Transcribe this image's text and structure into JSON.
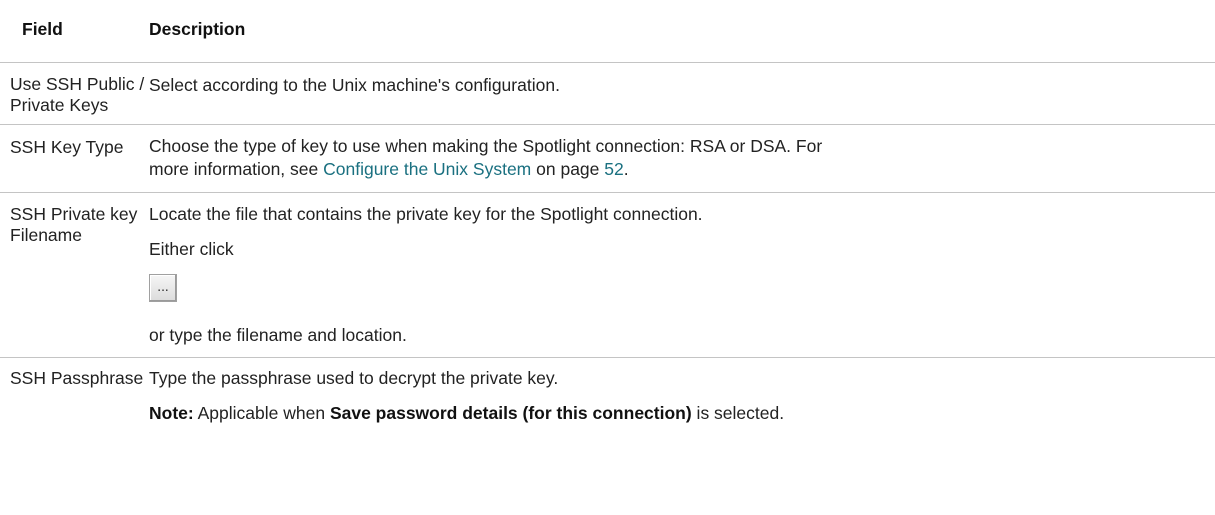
{
  "header": {
    "field": "Field",
    "description": "Description"
  },
  "rows": [
    {
      "field": "Use SSH Public / Private Keys",
      "description": "Select according to the Unix machine's configuration."
    },
    {
      "field": "SSH Key Type",
      "desc_line1": "Choose the type of key to use when making the Spotlight connection: RSA or DSA. For",
      "desc_line2_prefix": "more information, see ",
      "link_text": "Configure the Unix System",
      "desc_line2_mid": " on page ",
      "page_link": "52",
      "desc_line2_suffix": "."
    },
    {
      "field": "SSH Private key Filename",
      "desc_line1": "Locate the file that contains the private key for the Spotlight connection.",
      "desc_line2": "Either click",
      "button_label": "...",
      "desc_line3": "or type the filename and location."
    },
    {
      "field": "SSH Passphrase",
      "desc_line1": "Type the passphrase used to decrypt the private key.",
      "note_label": "Note:",
      "note_text": " Applicable when ",
      "note_bold": "Save password details (for this connection)",
      "note_suffix": " is selected."
    }
  ]
}
